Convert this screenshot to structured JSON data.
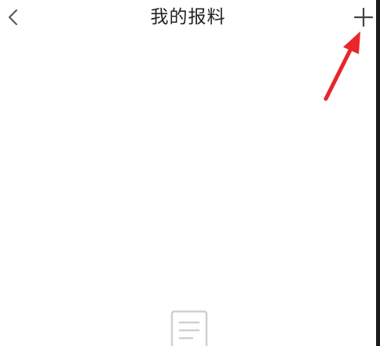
{
  "header": {
    "title": "我的报料",
    "back_icon": "chevron-left-icon",
    "add_icon": "plus-icon"
  },
  "annotation": {
    "icon": "red-arrow-icon",
    "color": "#e8262b"
  },
  "empty_state": {
    "icon": "document-icon",
    "color": "#d0d0d0"
  },
  "theme": {
    "background": "#ffffff",
    "text": "#222222",
    "icon": "#444444"
  }
}
